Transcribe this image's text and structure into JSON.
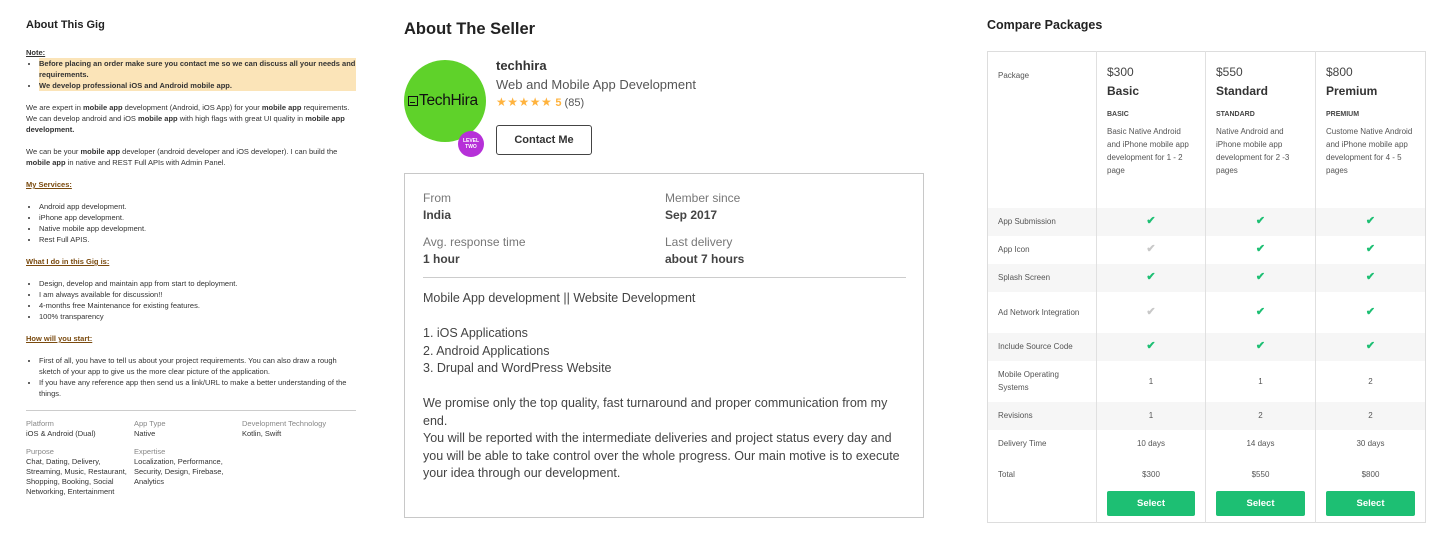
{
  "gig": {
    "title": "About This Gig",
    "note_label": "Note:",
    "notes": [
      "Before placing an order make sure you contact me so we can discuss all your needs and requirements.",
      "We develop professional iOS and Android mobile app."
    ],
    "p1": [
      {
        "t": "We are expert in ",
        "b": false
      },
      {
        "t": "mobile app",
        "b": true
      },
      {
        "t": " development (Android, iOS App) for your ",
        "b": false
      },
      {
        "t": "mobile app",
        "b": true
      },
      {
        "t": " requirements. We can develop android and iOS ",
        "b": false
      },
      {
        "t": "mobile app",
        "b": true
      },
      {
        "t": " with high flags with great UI quality in ",
        "b": false
      },
      {
        "t": "mobile app development.",
        "b": true
      }
    ],
    "p2": [
      {
        "t": "We can be your ",
        "b": false
      },
      {
        "t": "mobile app",
        "b": true
      },
      {
        "t": " developer (android developer and iOS developer). I can build the ",
        "b": false
      },
      {
        "t": "mobile app",
        "b": true
      },
      {
        "t": " in native and REST Full APIs with Admin Panel.",
        "b": false
      }
    ],
    "services_title": "My Services:",
    "services": [
      "Android app development.",
      "iPhone app development.",
      "Native mobile app development.",
      "Rest Full APIS."
    ],
    "doing_title": "What I do in this Gig is:",
    "doing": [
      "Design, develop and maintain app from start to deployment.",
      "I am always available for discussion!!",
      "4-months free Maintenance for existing features.",
      "100% transparency"
    ],
    "start_title": "How will you start:",
    "start": [
      "First of all, you have to tell us about your project requirements. You can also draw a rough sketch of your app to give us the more clear picture of the application.",
      "If you have any reference app then send us a link/URL to make a better understanding of the things."
    ],
    "meta": [
      {
        "label": "Platform",
        "value": "iOS & Android (Dual)"
      },
      {
        "label": "App Type",
        "value": "Native"
      },
      {
        "label": "Development Technology",
        "value": "Kotlin, Swift"
      },
      {
        "label": "Purpose",
        "value": "Chat, Dating, Delivery, Streaming, Music, Restaurant, Shopping, Booking, Social Networking, Entertainment"
      },
      {
        "label": "Expertise",
        "value": "Localization, Performance, Security, Design, Firebase, Analytics"
      }
    ]
  },
  "seller": {
    "section_title": "About The Seller",
    "avatar_logo": "TechHira",
    "level_badge": [
      "LEVEL",
      "TWO"
    ],
    "name": "techhira",
    "tagline": "Web and Mobile App Development",
    "stars": "★★★★★",
    "rating": "5",
    "reviews": "(85)",
    "contact_label": "Contact Me",
    "stats": [
      {
        "label": "From",
        "value": "India"
      },
      {
        "label": "Member since",
        "value": "Sep 2017"
      },
      {
        "label": "Avg. response time",
        "value": "1 hour"
      },
      {
        "label": "Last delivery",
        "value": "about 7 hours"
      }
    ],
    "desc_lines": [
      "Mobile App development || Website Development",
      "",
      "1. iOS Applications",
      "2. Android Applications",
      "3. Drupal and WordPress Website",
      "",
      "We promise only the top quality, fast turnaround and proper communication from my end.",
      "You will be reported with the intermediate deliveries and project status every day and you will be able to take control over the whole progress. Our main motive is to execute your idea through our development."
    ]
  },
  "compare": {
    "title": "Compare Packages",
    "package_label": "Package",
    "packages": [
      {
        "price": "$300",
        "name": "Basic",
        "tier": "BASIC",
        "desc": "Basic Native Android and iPhone mobile app development for 1 - 2 page"
      },
      {
        "price": "$550",
        "name": "Standard",
        "tier": "STANDARD",
        "desc": "Native Android and iPhone mobile app development for 2 -3 pages"
      },
      {
        "price": "$800",
        "name": "Premium",
        "tier": "PREMIUM",
        "desc": "Custome Native Android and iPhone mobile app development for 4 - 5 pages"
      }
    ],
    "rows": [
      {
        "label": "App Submission",
        "type": "check",
        "values": [
          true,
          true,
          true
        ],
        "h": 28
      },
      {
        "label": "App Icon",
        "type": "check",
        "values": [
          false,
          true,
          true
        ],
        "h": 28
      },
      {
        "label": "Splash Screen",
        "type": "check",
        "values": [
          true,
          true,
          true
        ],
        "h": 28
      },
      {
        "label": "Ad Network Integration",
        "type": "check",
        "values": [
          false,
          true,
          true
        ],
        "h": 41
      },
      {
        "label": "Include Source Code",
        "type": "check",
        "values": [
          true,
          true,
          true
        ],
        "h": 28
      },
      {
        "label": "Mobile Operating Systems",
        "type": "text",
        "values": [
          "1",
          "1",
          "2"
        ],
        "h": 41
      },
      {
        "label": "Revisions",
        "type": "text",
        "values": [
          "1",
          "2",
          "2"
        ],
        "h": 28
      },
      {
        "label": "Delivery Time",
        "type": "text",
        "values": [
          "10 days",
          "14 days",
          "30 days"
        ],
        "h": 28
      }
    ],
    "total_label": "Total",
    "totals": [
      "$300",
      "$550",
      "$800"
    ],
    "select_label": "Select",
    "check_glyph": "✔"
  }
}
